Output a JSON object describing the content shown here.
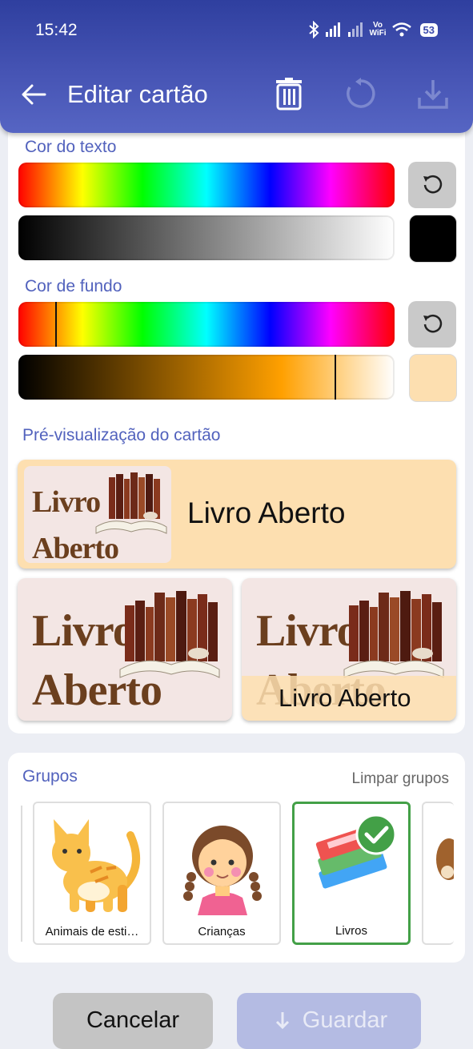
{
  "status": {
    "time": "15:42",
    "vowifi_top": "Vo",
    "vowifi_bottom": "WiFi",
    "battery": "53"
  },
  "appbar": {
    "title": "Editar cartão",
    "icons": [
      "arrow-back-icon",
      "trash-icon",
      "reset-icon",
      "download-icon"
    ]
  },
  "text_color": {
    "label": "Cor do texto",
    "hue_marker": null,
    "shade_marker": null,
    "selected_color": "#000000"
  },
  "bg_color": {
    "label": "Cor de fundo",
    "hue_marker_fraction": 0.1,
    "shade_marker_fraction": 0.84,
    "selected_color": "#fddfb0"
  },
  "preview": {
    "label": "Pré-visualização do cartão",
    "card_text": "Livro Aberto",
    "image_word_1": "Livro",
    "image_word_2": "Aberto",
    "tile_text": "Livro Aberto"
  },
  "groups": {
    "label": "Grupos",
    "clear_label": "Limpar grupos",
    "items": [
      {
        "label": "Animais de esti…",
        "icon": "cat-icon",
        "selected": false
      },
      {
        "label": "Crianças",
        "icon": "girl-icon",
        "selected": false
      },
      {
        "label": "Livros",
        "icon": "books-icon",
        "selected": true
      }
    ]
  },
  "buttons": {
    "cancel": "Cancelar",
    "save": "Guardar"
  }
}
